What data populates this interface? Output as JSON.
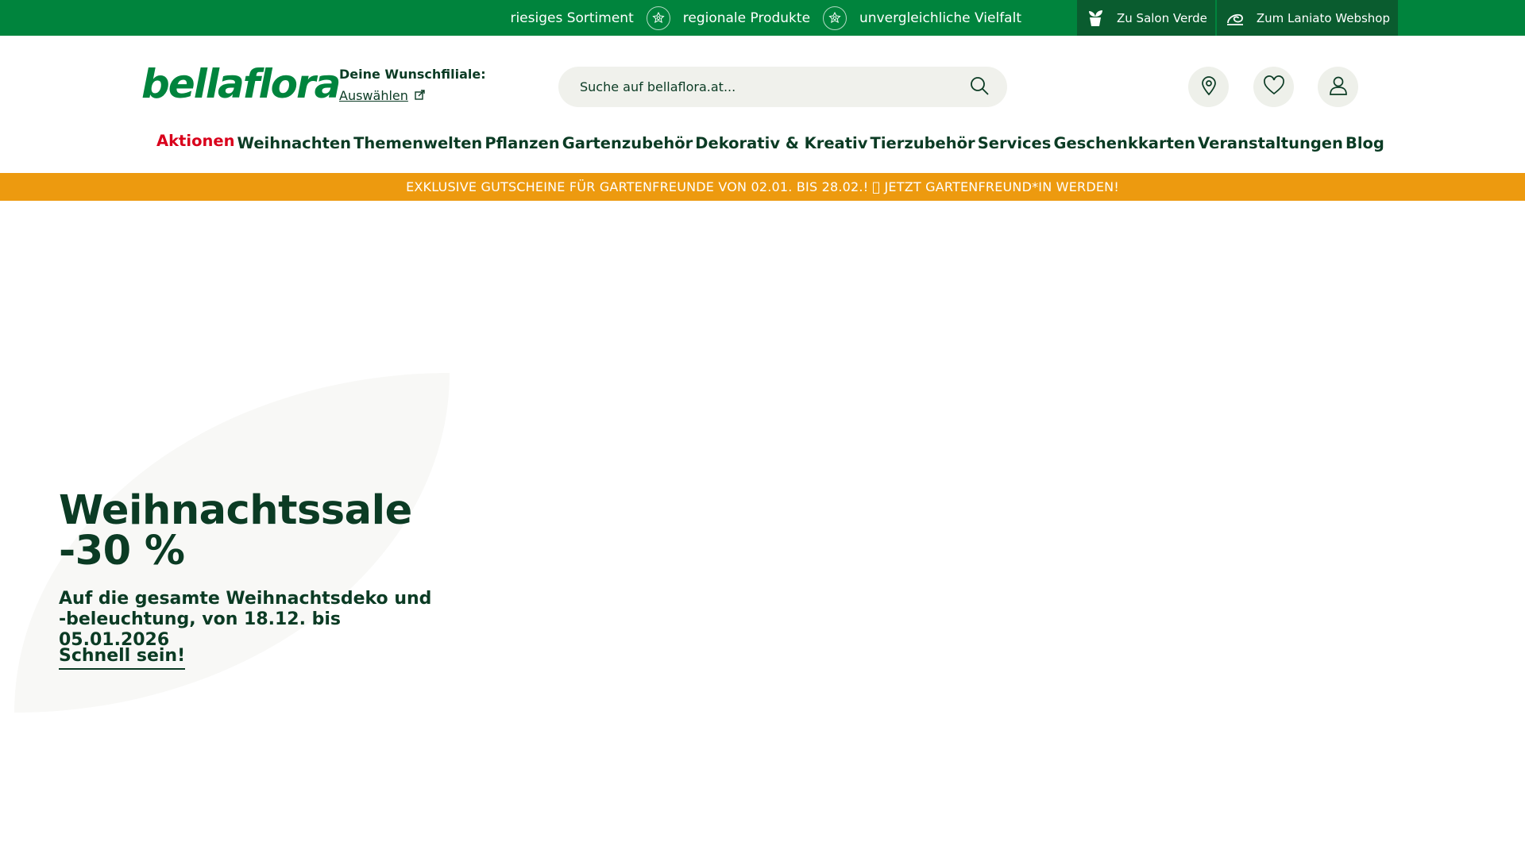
{
  "topbar": {
    "usps": [
      "riesiges Sortiment",
      "regionale Produkte",
      "unvergleichliche Vielfalt"
    ],
    "links": [
      {
        "label": "Zu Salon Verde",
        "icon": "plant-pot-icon"
      },
      {
        "label": "Zum Laniato Webshop",
        "icon": "snail-icon"
      }
    ],
    "background_color": "#00843d"
  },
  "header": {
    "logo_text": "bellaflora",
    "store_label": "Deine Wunschfiliale:",
    "store_link": "Auswählen",
    "search_placeholder": "Suche auf bellaflora.at...",
    "icons": [
      "location-pin-icon",
      "heart-icon",
      "user-icon"
    ]
  },
  "nav": {
    "items": [
      "Aktionen",
      "Weihnachten",
      "Themenwelten",
      "Pflanzen",
      "Gartenzubehör",
      "Dekorativ & Kreativ",
      "Tierzubehör",
      "Services",
      "Geschenkkarten",
      "Veranstaltungen",
      "Blog"
    ],
    "sale_color": "#d9001b"
  },
  "promo": {
    "text": "EXKLUSIVE GUTSCHEINE FÜR GARTENFREUNDE VON 02.01. BIS 28.02.! ⃞ JETZT GARTENFREUND*IN WERDEN!",
    "background_color": "#ed9a0f"
  },
  "hero": {
    "title": "Weihnachtssale -30 %",
    "subtitle": "Auf die gesamte Weihnachtsdeko und -beleuchtung, von 18.12. bis 05.01.2026",
    "cta": "Schnell sein!"
  }
}
